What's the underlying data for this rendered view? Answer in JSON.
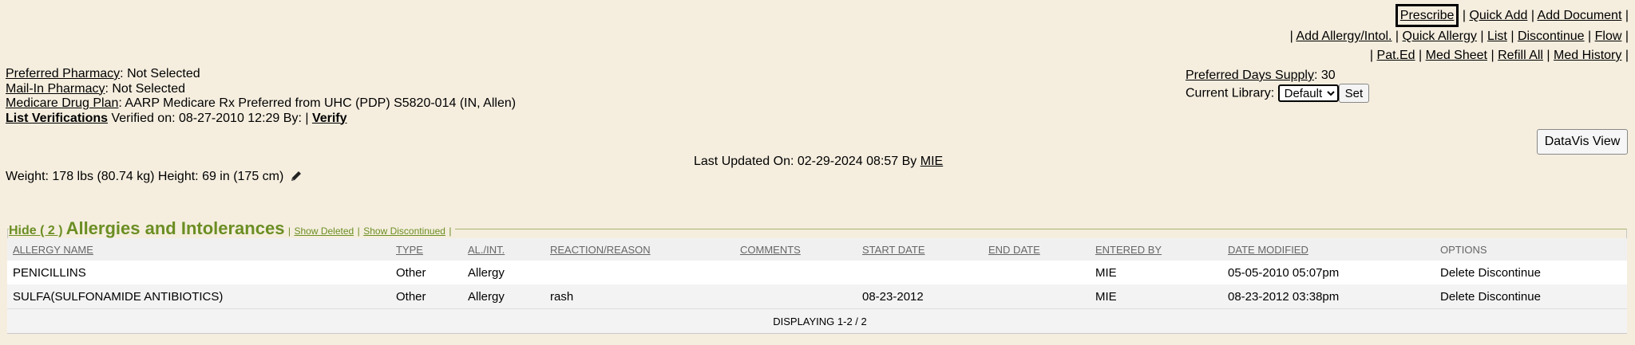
{
  "toolbar": {
    "row1": [
      "Prescribe",
      "Quick Add",
      "Add Document"
    ],
    "row2": [
      "Add Allergy/Intol.",
      "Quick Allergy",
      "List",
      "Discontinue",
      "Flow"
    ],
    "row3": [
      "Pat.Ed",
      "Med Sheet",
      "Refill All",
      "Med History"
    ]
  },
  "info": {
    "pharmacy_label": "Preferred Pharmacy",
    "pharmacy_value": ": Not Selected",
    "mail_label": "Mail-In Pharmacy",
    "mail_value": ": Not Selected",
    "plan_label": "Medicare Drug Plan",
    "plan_value": ": AARP Medicare Rx Preferred from UHC (PDP) S5820-014 (IN, Allen)",
    "verif_label": "List Verifications",
    "verif_value": " Verified on: 08-27-2010 12:29 By: | ",
    "verify_link": "Verify"
  },
  "settings": {
    "days_label": "Preferred Days Supply",
    "days_value": ": 30",
    "library_label": "Current Library:",
    "library_selected": "Default",
    "set_button": "Set"
  },
  "datavis_button": "DataVis View",
  "last_updated": {
    "text": "Last Updated On: 02-29-2024 08:57 By ",
    "by": "MIE"
  },
  "vitals": "Weight: 178 lbs (80.74 kg) Height: 69 in (175 cm)",
  "allergies": {
    "hide_link": "Hide ( 2 )",
    "title": "Allergies and Intolerances",
    "show_deleted": "Show Deleted",
    "show_discontinued": "Show Discontinued",
    "columns": [
      "ALLERGY NAME",
      "TYPE",
      "AL./INT.",
      "REACTION/REASON",
      "COMMENTS",
      "START DATE",
      "END DATE",
      "ENTERED BY",
      "DATE MODIFIED",
      "OPTIONS"
    ],
    "rows": [
      {
        "name": "PENICILLINS",
        "type": "Other",
        "alint": "Allergy",
        "reaction": "",
        "comments": "",
        "start": "",
        "end": "",
        "entered_by": "MIE",
        "modified": "05-05-2010 05:07pm",
        "delete": "Delete",
        "discontinue": "Discontinue"
      },
      {
        "name": "SULFA(SULFONAMIDE ANTIBIOTICS)",
        "type": "Other",
        "alint": "Allergy",
        "reaction": "rash",
        "comments": "",
        "start": "08-23-2012",
        "end": "",
        "entered_by": "MIE",
        "modified": "08-23-2012 03:38pm",
        "delete": "Delete",
        "discontinue": "Discontinue"
      }
    ],
    "footer": "DISPLAYING 1-2 / 2"
  },
  "icons": {
    "edit": "pencil-icon"
  }
}
